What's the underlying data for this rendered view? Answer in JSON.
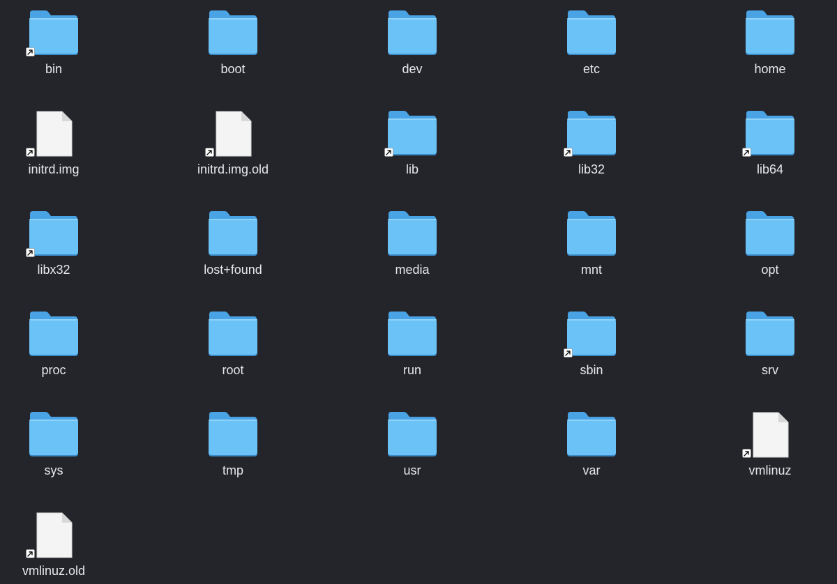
{
  "colors": {
    "background": "#24252b",
    "folder_front": "#6ac2f6",
    "folder_back": "#4aa3e4",
    "folder_shadow": "#3b8bc9",
    "file_body": "#f4f4f4",
    "label": "#e8e8ea"
  },
  "items": [
    {
      "name": "bin",
      "kind": "folder",
      "alias": true
    },
    {
      "name": "boot",
      "kind": "folder",
      "alias": false
    },
    {
      "name": "dev",
      "kind": "folder",
      "alias": false
    },
    {
      "name": "etc",
      "kind": "folder",
      "alias": false
    },
    {
      "name": "home",
      "kind": "folder",
      "alias": false
    },
    {
      "name": "initrd.img",
      "kind": "file",
      "alias": true
    },
    {
      "name": "initrd.img.old",
      "kind": "file",
      "alias": true
    },
    {
      "name": "lib",
      "kind": "folder",
      "alias": true
    },
    {
      "name": "lib32",
      "kind": "folder",
      "alias": true
    },
    {
      "name": "lib64",
      "kind": "folder",
      "alias": true
    },
    {
      "name": "libx32",
      "kind": "folder",
      "alias": true
    },
    {
      "name": "lost+found",
      "kind": "folder",
      "alias": false
    },
    {
      "name": "media",
      "kind": "folder",
      "alias": false
    },
    {
      "name": "mnt",
      "kind": "folder",
      "alias": false
    },
    {
      "name": "opt",
      "kind": "folder",
      "alias": false
    },
    {
      "name": "proc",
      "kind": "folder",
      "alias": false
    },
    {
      "name": "root",
      "kind": "folder",
      "alias": false
    },
    {
      "name": "run",
      "kind": "folder",
      "alias": false
    },
    {
      "name": "sbin",
      "kind": "folder",
      "alias": true
    },
    {
      "name": "srv",
      "kind": "folder",
      "alias": false
    },
    {
      "name": "sys",
      "kind": "folder",
      "alias": false
    },
    {
      "name": "tmp",
      "kind": "folder",
      "alias": false
    },
    {
      "name": "usr",
      "kind": "folder",
      "alias": false
    },
    {
      "name": "var",
      "kind": "folder",
      "alias": false
    },
    {
      "name": "vmlinuz",
      "kind": "file",
      "alias": true
    },
    {
      "name": "vmlinuz.old",
      "kind": "file",
      "alias": true
    }
  ]
}
